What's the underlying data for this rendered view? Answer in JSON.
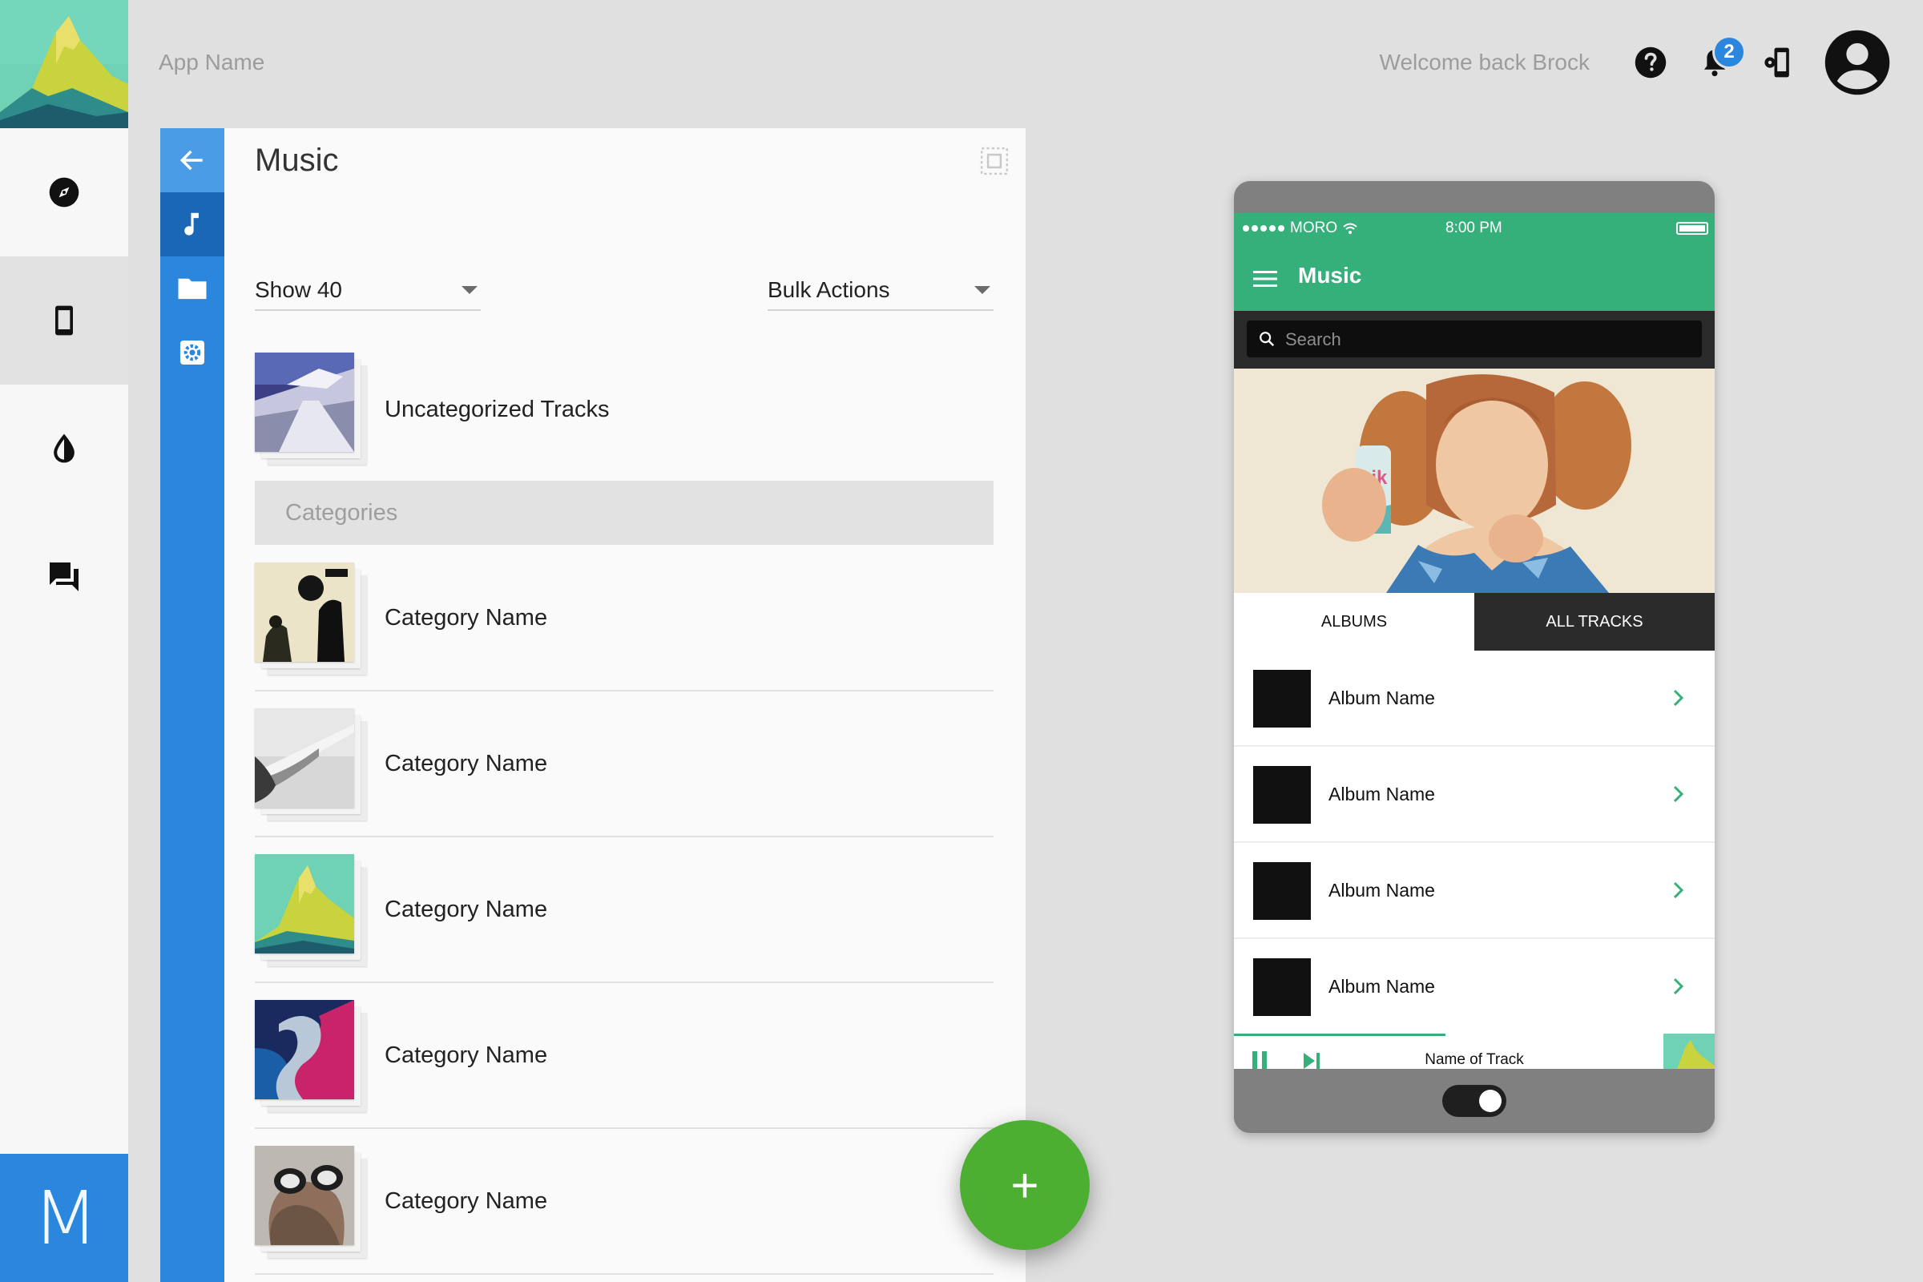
{
  "top_bar": {
    "app_name": "App Name",
    "welcome": "Welcome back Brock",
    "notification_count": "2",
    "icons": [
      "help-icon",
      "bell-icon",
      "device-settings-icon",
      "account-avatar-icon"
    ]
  },
  "rail": {
    "logo": "mountain-logo",
    "items": [
      {
        "icon": "compass-icon",
        "active": false
      },
      {
        "icon": "phone-icon",
        "active": true
      },
      {
        "icon": "drop-icon",
        "active": false
      },
      {
        "icon": "forum-icon",
        "active": false
      }
    ],
    "brand_letter": "M"
  },
  "side_nav": {
    "items": [
      "back-arrow-icon",
      "music-note-icon",
      "folder-icon",
      "settings-icon"
    ],
    "active": "music-note-icon"
  },
  "music_panel": {
    "title": "Music",
    "show_dropdown": "Show 40",
    "bulk_dropdown": "Bulk Actions",
    "uncategorized_label": "Uncategorized Tracks",
    "section_label": "Categories",
    "categories": [
      {
        "name": "Category Name"
      },
      {
        "name": "Category Name"
      },
      {
        "name": "Category Name"
      },
      {
        "name": "Category Name"
      },
      {
        "name": "Category Name"
      }
    ],
    "fab_label": "+"
  },
  "phone": {
    "status": {
      "carrier": "MORO",
      "time": "8:00 PM"
    },
    "app_title": "Music",
    "search_placeholder": "Search",
    "tabs": [
      {
        "label": "ALBUMS",
        "active": false
      },
      {
        "label": "ALL TRACKS",
        "active": true
      }
    ],
    "albums": [
      {
        "name": "Album Name"
      },
      {
        "name": "Album Name"
      },
      {
        "name": "Album Name"
      },
      {
        "name": "Album Name"
      }
    ],
    "now_playing": "Name of Track",
    "progress": 0.44
  },
  "colors": {
    "accent_blue": "#2a87dd",
    "phone_green": "#36b07b",
    "fab_green": "#4caf32"
  }
}
